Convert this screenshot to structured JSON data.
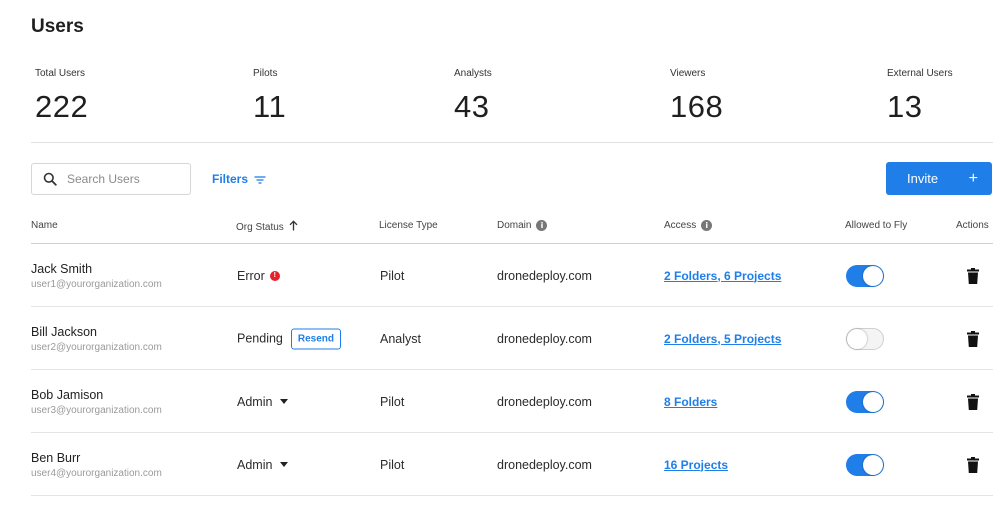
{
  "page": {
    "title": "Users"
  },
  "stats": [
    {
      "label": "Total Users",
      "value": "222"
    },
    {
      "label": "Pilots",
      "value": "11"
    },
    {
      "label": "Analysts",
      "value": "43"
    },
    {
      "label": "Viewers",
      "value": "168"
    },
    {
      "label": "External Users",
      "value": "13"
    }
  ],
  "toolbar": {
    "search_placeholder": "Search Users",
    "filters_label": "Filters",
    "invite_label": "Invite",
    "invite_icon": "+"
  },
  "table": {
    "columns": {
      "name": "Name",
      "org_status": "Org Status",
      "license_type": "License Type",
      "domain": "Domain",
      "access": "Access",
      "allowed_to_fly": "Allowed to Fly",
      "actions": "Actions"
    },
    "sort": {
      "column": "Org Status",
      "direction": "ascending",
      "icon": "arrow-up-icon"
    },
    "rows": [
      {
        "name": "Jack Smith",
        "email": "user1@yourorganization.com",
        "status": "Error",
        "license": "Pilot",
        "domain": "dronedeploy.com",
        "access": "2 Folders, 6 Projects",
        "allowed_to_fly": true
      },
      {
        "name": "Bill Jackson",
        "email": "user2@yourorganization.com",
        "status": "Pending",
        "status_action": "Resend",
        "license": "Analyst",
        "domain": "dronedeploy.com",
        "access": "2 Folders, 5 Projects",
        "allowed_to_fly": false
      },
      {
        "name": "Bob Jamison",
        "email": "user3@yourorganization.com",
        "status": "Admin",
        "license": "Pilot",
        "domain": "dronedeploy.com",
        "access": "8 Folders",
        "allowed_to_fly": true
      },
      {
        "name": "Ben Burr",
        "email": "user4@yourorganization.com",
        "status": "Admin",
        "license": "Pilot",
        "domain": "dronedeploy.com",
        "access": "16 Projects",
        "allowed_to_fly": true
      }
    ]
  },
  "colors": {
    "accent": "#1f7ee8",
    "error": "#e8202a",
    "text": "#2b2b2b",
    "muted": "#9a9a9a"
  }
}
